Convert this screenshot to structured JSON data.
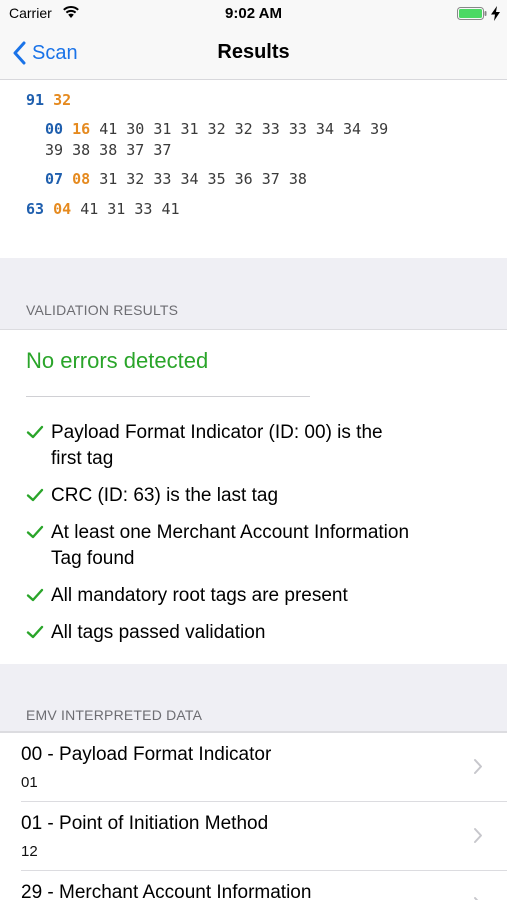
{
  "status_bar": {
    "carrier": "Carrier",
    "time": "9:02 AM",
    "battery_level": 1.0
  },
  "nav": {
    "back_label": "Scan",
    "title": "Results"
  },
  "raw_data": {
    "lines": [
      {
        "id": "91",
        "len": "32",
        "bytes": ""
      },
      {
        "id": "00",
        "len": "16",
        "bytes": "41 30 31 31 32 32 33 33 34 34 39"
      },
      {
        "id": "",
        "len": "",
        "bytes": "39 38 38 37 37"
      },
      {
        "id": "07",
        "len": "08",
        "bytes": "31 32 33 34 35 36 37 38"
      },
      {
        "id": "63",
        "len": "04",
        "bytes": "41 31 33 41"
      }
    ]
  },
  "validation": {
    "header": "VALIDATION RESULTS",
    "status": "No errors detected",
    "status_color": "#2aa52a",
    "checks": [
      {
        "line1": "Payload Format Indicator (ID: 00) is the",
        "line2": "first tag"
      },
      {
        "line1": "CRC (ID: 63) is the last tag",
        "line2": ""
      },
      {
        "line1": "At least one Merchant Account Information",
        "line2": "Tag found"
      },
      {
        "line1": "All mandatory root tags are present",
        "line2": ""
      },
      {
        "line1": "All tags passed validation",
        "line2": ""
      }
    ]
  },
  "emv": {
    "header": "EMV INTERPRETED DATA",
    "rows": [
      {
        "title": "00 - Payload Format Indicator",
        "value": "01"
      },
      {
        "title": "01 - Point of Initiation Method",
        "value": "12"
      },
      {
        "title": "29 - Merchant Account Information",
        "value": ""
      }
    ]
  },
  "colors": {
    "accent": "#1a73e8",
    "tag_id": "#1f5fae",
    "tag_length": "#e58a1f",
    "success": "#2aa52a"
  }
}
